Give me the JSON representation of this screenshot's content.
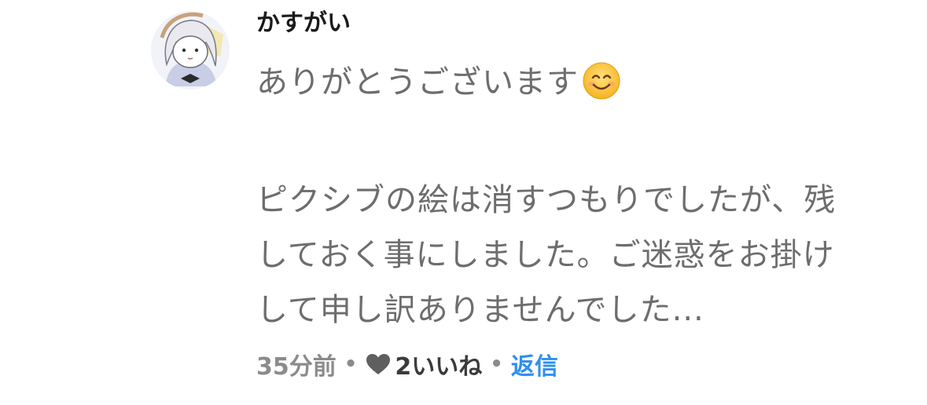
{
  "comment": {
    "author": "かすがい",
    "lines": [
      "ありがとうございます",
      "",
      "ピクシブの絵は消すつもりでしたが、残",
      "しておく事にしました。ご迷惑をお掛け",
      "して申し訳ありませんでした..."
    ],
    "emoji": "smiling-face-icon",
    "timestamp": "35分前",
    "separator": "•",
    "like_count_label": "2いいね",
    "reply_label": "返信"
  },
  "colors": {
    "author": "#1a1a1a",
    "body_text": "#6d6d6d",
    "meta_text": "#8b8b8b",
    "reply_link": "#2f8ff0",
    "heart": "#5f5f5f"
  }
}
